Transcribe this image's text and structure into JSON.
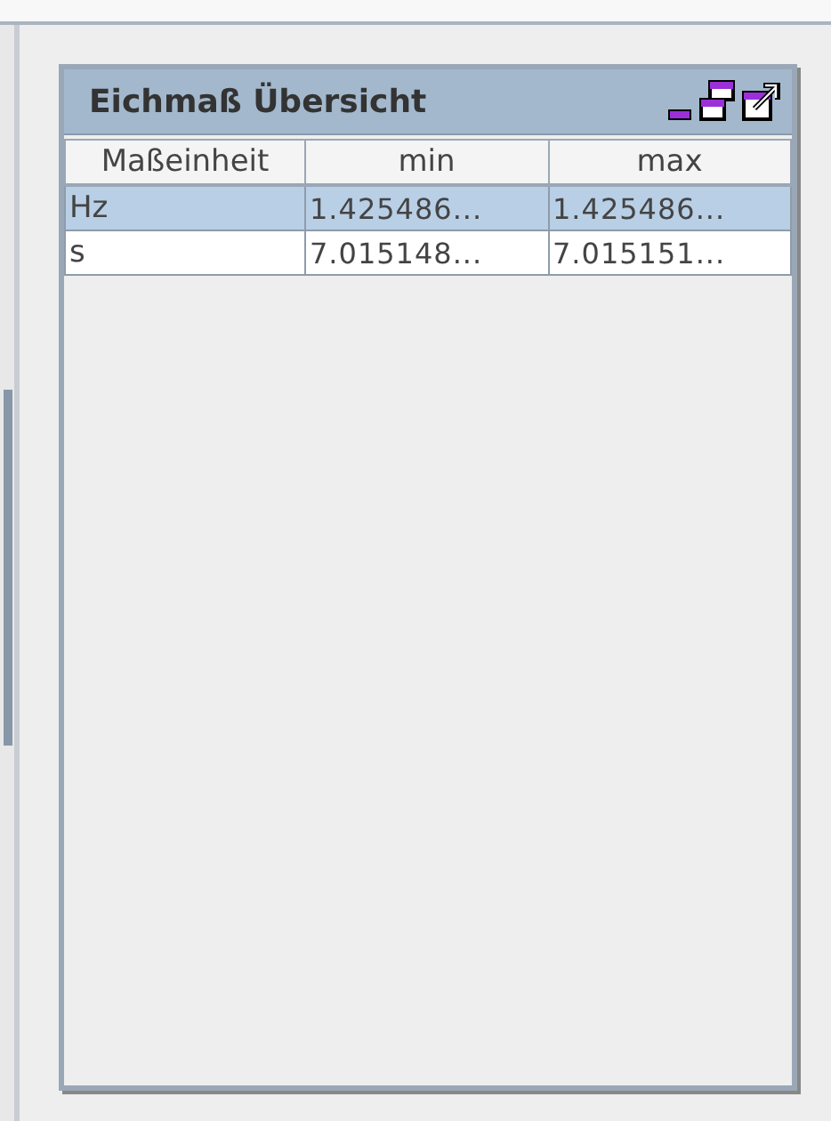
{
  "panel": {
    "title": "Eichmaß Übersicht"
  },
  "table": {
    "columns": [
      "Maßeinheit",
      "min",
      "max"
    ],
    "rows": [
      {
        "cells": [
          "Hz",
          "1.425486...",
          "1.425486..."
        ],
        "selected": true
      },
      {
        "cells": [
          "s",
          "7.015148...",
          "7.015151..."
        ],
        "selected": false
      }
    ]
  }
}
